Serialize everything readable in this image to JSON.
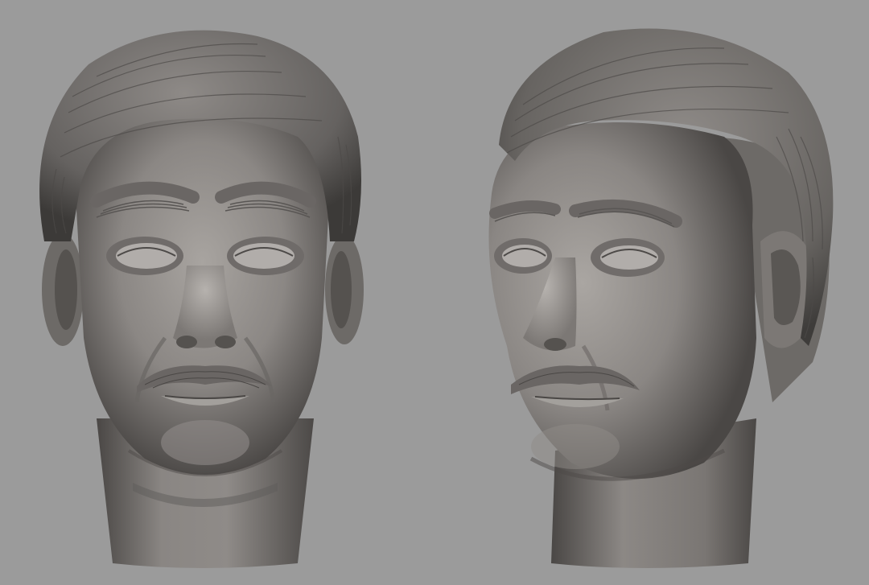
{
  "scene": {
    "background_color": "#9b9b9b",
    "clay_color": "#7f7b78",
    "clay_light": "#a9a5a1",
    "clay_dark": "#3e3b39",
    "hair_color": "#6a6764"
  },
  "views": [
    {
      "id": "front",
      "icon": "sculpt-head-front-view"
    },
    {
      "id": "three-quarter",
      "icon": "sculpt-head-three-quarter-view"
    }
  ]
}
